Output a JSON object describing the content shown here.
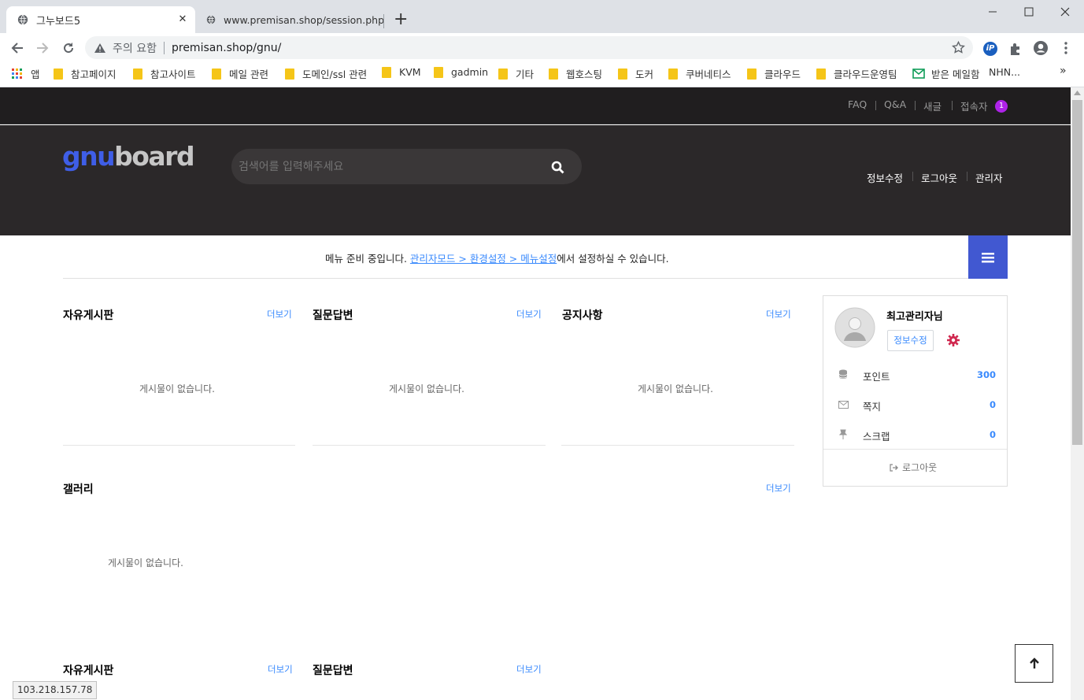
{
  "browser": {
    "tabs": [
      {
        "title": "그누보드5",
        "icon": "globe-icon",
        "close": "✕"
      },
      {
        "title": "www.premisan.shop/session.php",
        "icon": "globe-icon",
        "close": "✕"
      }
    ],
    "new_tab": "+",
    "window_controls": [
      "minimize",
      "maximize",
      "close"
    ],
    "security_label": "주의 요함",
    "url": "premisan.shop/gnu/",
    "bookmarks": [
      "앱",
      "참고페이지",
      "참고사이트",
      "메일 관련",
      "도메인/ssl 관련",
      "KVM",
      "gadmin",
      "기타",
      "웹호스팅",
      "도커",
      "쿠버네티스",
      "클라우드",
      "클라우드운영팀",
      "받은 메일함",
      "NHN..."
    ],
    "bookmarks_more": "»",
    "status_url": "103.218.157.78"
  },
  "site": {
    "top_links": [
      "FAQ",
      "Q&A",
      "새글",
      "접속자"
    ],
    "online_count": "1",
    "logo": {
      "part1": "gnu",
      "part2": "board"
    },
    "search_placeholder": "검색어를 입력해주세요",
    "header_links": [
      "정보수정",
      "로그아웃",
      "관리자"
    ],
    "menu_notice": {
      "prefix": "메뉴 준비 중입니다. ",
      "link": "관리자모드 > 환경설정 > 메뉴설정",
      "suffix": "에서 설정하실 수 있습니다."
    },
    "boards_row1": [
      {
        "title": "자유게시판",
        "more": "더보기",
        "empty": "게시물이 없습니다."
      },
      {
        "title": "질문답변",
        "more": "더보기",
        "empty": "게시물이 없습니다."
      },
      {
        "title": "공지사항",
        "more": "더보기",
        "empty": "게시물이 없습니다."
      }
    ],
    "gallery": {
      "title": "갤러리",
      "more": "더보기",
      "empty": "게시물이 없습니다."
    },
    "boards_row2": [
      {
        "title": "자유게시판",
        "more": "더보기"
      },
      {
        "title": "질문답변",
        "more": "더보기"
      }
    ],
    "outlogin": {
      "nickname": "최고관리자님",
      "edit_button": "정보수정",
      "rows": [
        {
          "label": "포인트",
          "value": "300",
          "icon": "database-icon"
        },
        {
          "label": "쪽지",
          "value": "0",
          "icon": "envelope-icon"
        },
        {
          "label": "스크랩",
          "value": "0",
          "icon": "pin-icon"
        }
      ],
      "logout": "로그아웃"
    }
  },
  "colors": {
    "accent": "#3a8afd",
    "menu_button": "#4158d1",
    "badge": "#ae23e8",
    "header_bg": "#2b2829",
    "tnb_bg": "#201e1f"
  }
}
